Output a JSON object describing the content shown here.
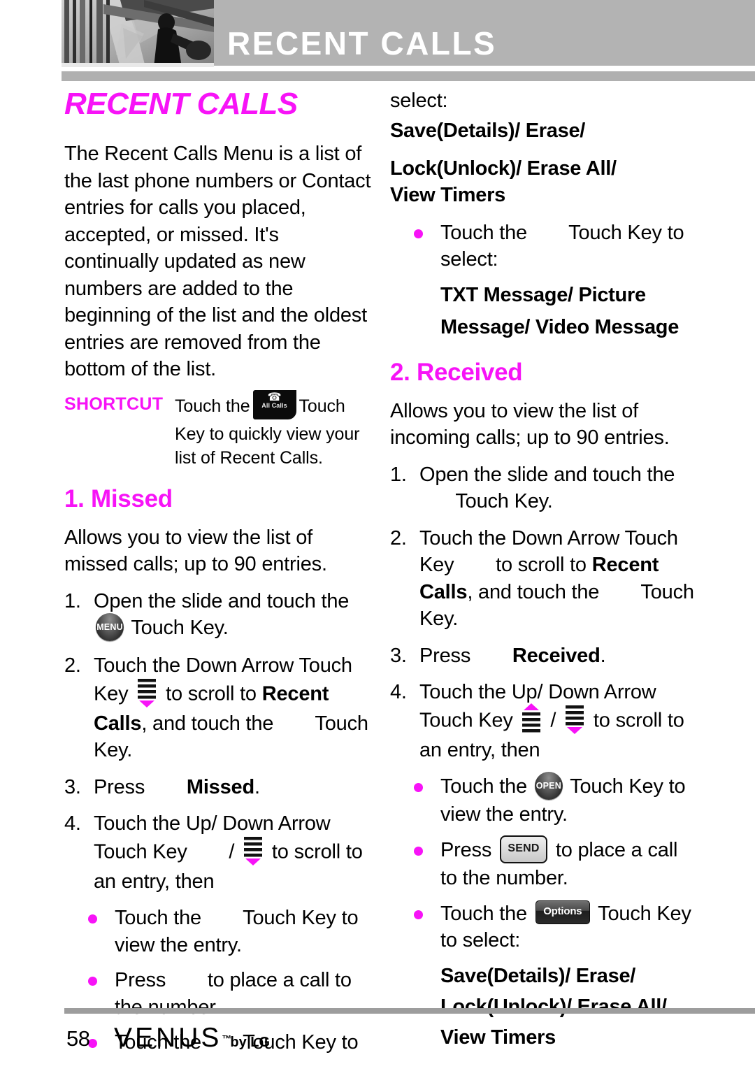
{
  "header": {
    "title": "RECENT CALLS",
    "photo_alt": "grayscale-architecture-photo"
  },
  "chapter": {
    "title": "RECENT CALLS"
  },
  "intro": {
    "paragraph": "The Recent Calls Menu is a list of the last phone numbers or Contact entries for calls you placed, accepted, or missed. It's continually updated as new numbers are added to the beginning of the list and the oldest entries are removed from the bottom of the list."
  },
  "shortcut": {
    "label": "SHORTCUT",
    "text_before": "Touch the",
    "icon_label": "All Calls",
    "icon_name": "all-calls-touch-key",
    "text_after": "Touch Key to quickly view your list of Recent Calls."
  },
  "sections": [
    {
      "heading": "1. Missed",
      "description": "Allows you to view the list of missed calls; up to 90 entries.",
      "steps": [
        {
          "num": "1.",
          "a": "Open the slide and touch the",
          "icon": "MENU",
          "b": "Touch Key."
        },
        {
          "num": "2.",
          "a": "Touch the Down Arrow Touch Key",
          "icon": "down-arrow",
          "b": "to scroll to",
          "bold": "Recent Calls",
          "c": ", and touch the",
          "icon2": "blank",
          "d": "Touch Key."
        },
        {
          "num": "3.",
          "a": "Press",
          "icon": "blank",
          "bold": "Missed",
          "c": "."
        },
        {
          "num": "4.",
          "a": "Touch the Up/ Down Arrow Touch Key",
          "icon": "blank",
          "sep": "/",
          "icon2": "down-arrow",
          "b": "to scroll to an entry, then"
        }
      ],
      "bullets": [
        {
          "a": "Touch the",
          "icon": "blank",
          "b": "Touch Key to view the entry."
        },
        {
          "a": "Press",
          "icon": "blank",
          "b": "to place a call to the number."
        },
        {
          "a": "Touch the",
          "icon": "blank",
          "b": "Touch Key to"
        }
      ]
    },
    {
      "heading": "2. Received",
      "description": "Allows you to view the list of incoming calls; up to 90 entries.",
      "steps": [
        {
          "num": "1.",
          "a": "Open the slide and touch the",
          "icon": "blank",
          "b": "Touch Key."
        },
        {
          "num": "2.",
          "a": "Touch the Down Arrow Touch Key",
          "icon": "blank",
          "b": "to scroll to",
          "bold": "Recent Calls",
          "c": ", and touch the",
          "icon2": "blank",
          "d": "Touch Key."
        },
        {
          "num": "3.",
          "a": "Press",
          "icon": "blank",
          "bold": "Received",
          "c": "."
        },
        {
          "num": "4.",
          "a": "Touch the Up/ Down Arrow Touch Key",
          "icon": "up-arrow",
          "sep": "/",
          "icon2": "down-arrow",
          "b": "to scroll to an entry, then"
        }
      ],
      "bullets": [
        {
          "a": "Touch the",
          "icon": "OPEN",
          "b": "Touch Key to view the entry."
        },
        {
          "a": "Press",
          "icon": "SEND",
          "b": "to place a call to the number."
        },
        {
          "a": "Touch the",
          "icon": "Options",
          "b": "Touch Key to select:"
        }
      ]
    }
  ],
  "carryover": {
    "select_label": "select:",
    "menu_line1": "Save(Details)/ Erase/",
    "menu_line2": "Lock(Unlock)/ Erase All/",
    "menu_line3": "View Timers",
    "bullet_a": "Touch the",
    "bullet_b": "Touch Key to",
    "bullet_c": "select:",
    "menu2_line1": "TXT Message/ Picture",
    "menu2_line2": "Message/ Video Message"
  },
  "received_options": {
    "menu_line1": "Save(Details)/ Erase/",
    "menu_line2": "Lock(Unlock)/ Erase All/",
    "menu_line3": "View Timers"
  },
  "icon_labels": {
    "menu": "MENU",
    "open": "OPEN",
    "send": "SEND",
    "options": "Options",
    "all_calls": "All Calls"
  },
  "footer": {
    "page_number": "58",
    "brand": "VENUS",
    "tm": "™",
    "by": "by LG"
  },
  "colors": {
    "accent": "#f713f7",
    "header_band": "#b3b3b3",
    "rule": "#9d9d9d"
  }
}
